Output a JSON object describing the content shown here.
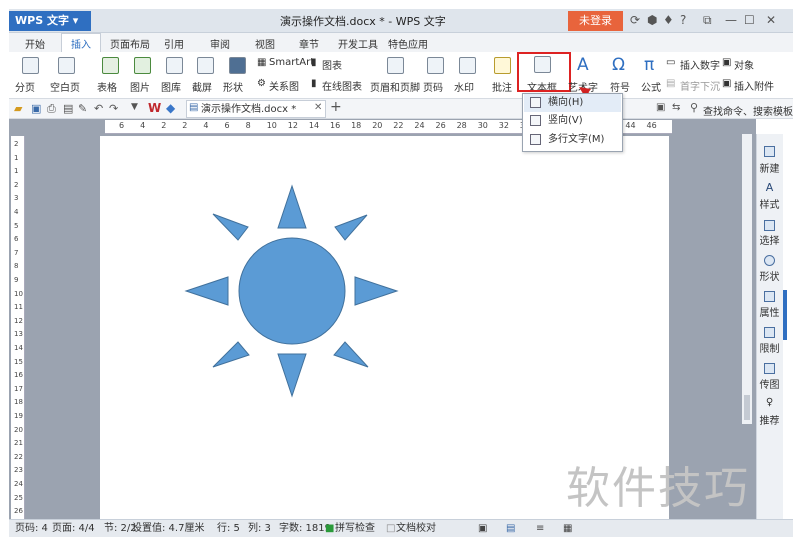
{
  "title_bar": {
    "app_name": "WPS 文字",
    "doc_title": "演示操作文档.docx * - WPS 文字",
    "login": "未登录",
    "help": "?"
  },
  "tabs": [
    "开始",
    "插入",
    "页面布局",
    "引用",
    "审阅",
    "视图",
    "章节",
    "开发工具",
    "特色应用"
  ],
  "ribbon": {
    "paging": [
      "分页",
      "空白页"
    ],
    "insert_objects": [
      "表格",
      "图片",
      "图库",
      "截屏",
      "形状"
    ],
    "smartart": "SmartArt",
    "chart": "图表",
    "relation": "关系图",
    "online_chart": "在线图表",
    "header_footer": "页眉和页脚",
    "page_number": "页码",
    "watermark_btn": "水印",
    "comment": "批注",
    "textbox": "文本框",
    "wordart": "艺术字",
    "symbol": "符号",
    "formula": "公式",
    "insert_number": "插入数字",
    "object": "对象",
    "drop_cap": "首字下沉",
    "insert_attachment": "插入附件"
  },
  "toolbar2": {
    "doc_tab": "演示操作文档.docx *",
    "search": "查找命令、搜索模板",
    "add": "+"
  },
  "ruler_numbers": [
    "6",
    "4",
    "2",
    "2",
    "4",
    "6",
    "8",
    "10",
    "12",
    "14",
    "16",
    "18",
    "20",
    "22",
    "24",
    "26",
    "28",
    "30",
    "32",
    "34",
    "36",
    "38",
    "40",
    "42",
    "44",
    "46"
  ],
  "vruler_numbers": [
    "2",
    "1",
    "1",
    "2",
    "3",
    "4",
    "5",
    "6",
    "7",
    "8",
    "9",
    "10",
    "11",
    "12",
    "13",
    "14",
    "15",
    "16",
    "17",
    "18",
    "19",
    "20",
    "21",
    "22",
    "23",
    "24",
    "25",
    "26"
  ],
  "right_panel": [
    "新建",
    "样式",
    "选择",
    "形状",
    "属性",
    "限制",
    "传图",
    "推荐"
  ],
  "dropdown": [
    "横向(H)",
    "竖向(V)",
    "多行文字(M)"
  ],
  "status": {
    "page": "页码: 4",
    "pages": "页面: 4/4",
    "section": "节: 2/2",
    "setting": "设置值: 4.7厘米",
    "row": "行: 5",
    "col": "列: 3",
    "words": "字数: 1819",
    "spell": "拼写检查",
    "proof": "文档校对"
  },
  "watermark_text": "软件技巧",
  "colors": {
    "accent": "#2f6fc1",
    "login": "#e8643c",
    "sun": "#5b9bd5",
    "highlight": "#d22222"
  }
}
